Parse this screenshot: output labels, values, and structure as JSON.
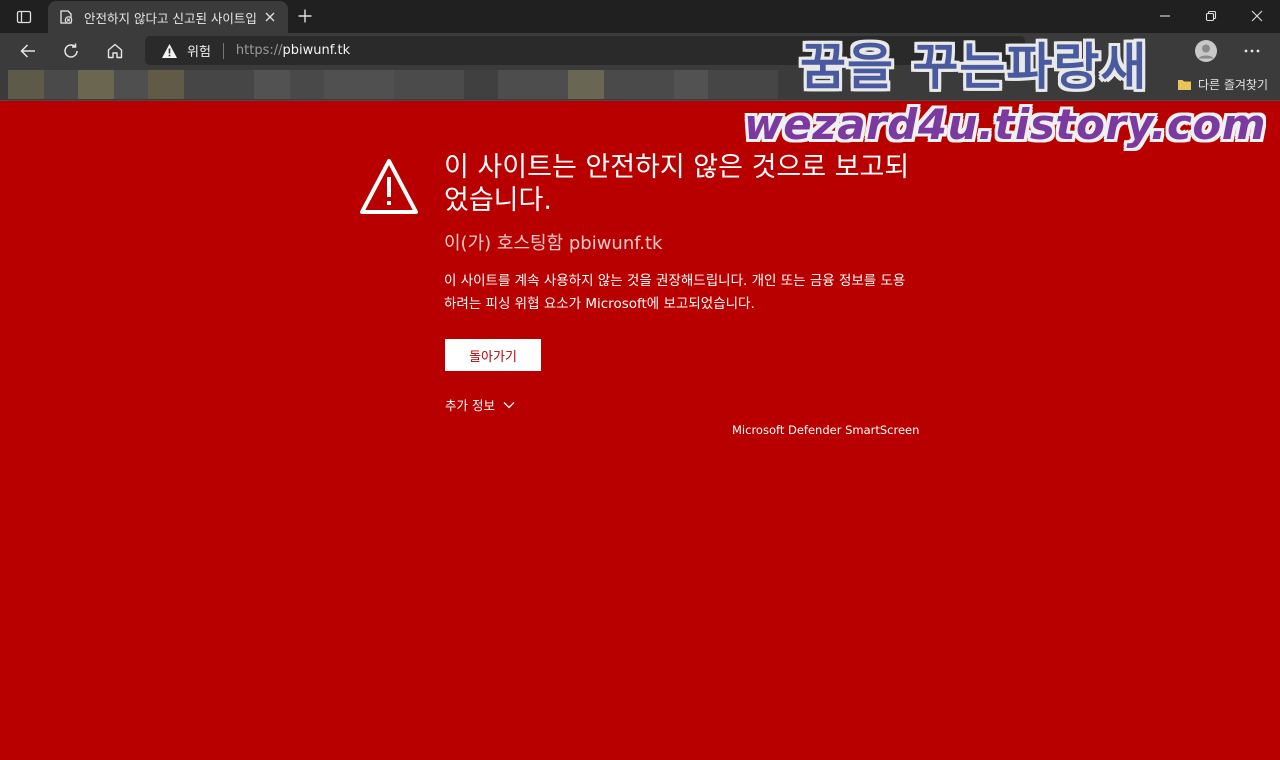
{
  "tab": {
    "title": "안전하지 않다고 신고된 사이트입니다"
  },
  "address": {
    "warning_label": "위험",
    "url_scheme": "https://",
    "url_host": "pbiwunf.tk"
  },
  "favorites": {
    "other_label": "다른 즐겨찾기"
  },
  "watermark": {
    "line1": "꿈을 꾸는파랑새",
    "line2": "wezard4u.tistory.com"
  },
  "page": {
    "headline": "이 사이트는 안전하지 않은 것으로 보고되었습니다.",
    "hosted_by": "이(가) 호스팅함 pbiwunf.tk",
    "description": "이 사이트를 계속 사용하지 않는 것을 권장해드립니다. 개인 또는 금융 정보를 도용하려는 피싱 위협 요소가 Microsoft에 보고되었습니다.",
    "back_button": "돌아가기",
    "more_info": "추가 정보",
    "footer": "Microsoft Defender SmartScreen"
  },
  "colors": {
    "page_background": "#b80000",
    "chrome_dark": "#202020",
    "toolbar": "#3b3b3b",
    "text_white": "#ffffff"
  },
  "icons": [
    "sidebar-icon",
    "shield-x-icon",
    "close-icon",
    "plus-icon",
    "minimize-icon",
    "restore-icon",
    "back-arrow-icon",
    "refresh-icon",
    "home-icon",
    "warning-triangle-icon",
    "avatar-icon",
    "more-icon",
    "folder-icon",
    "chevron-down-icon"
  ]
}
